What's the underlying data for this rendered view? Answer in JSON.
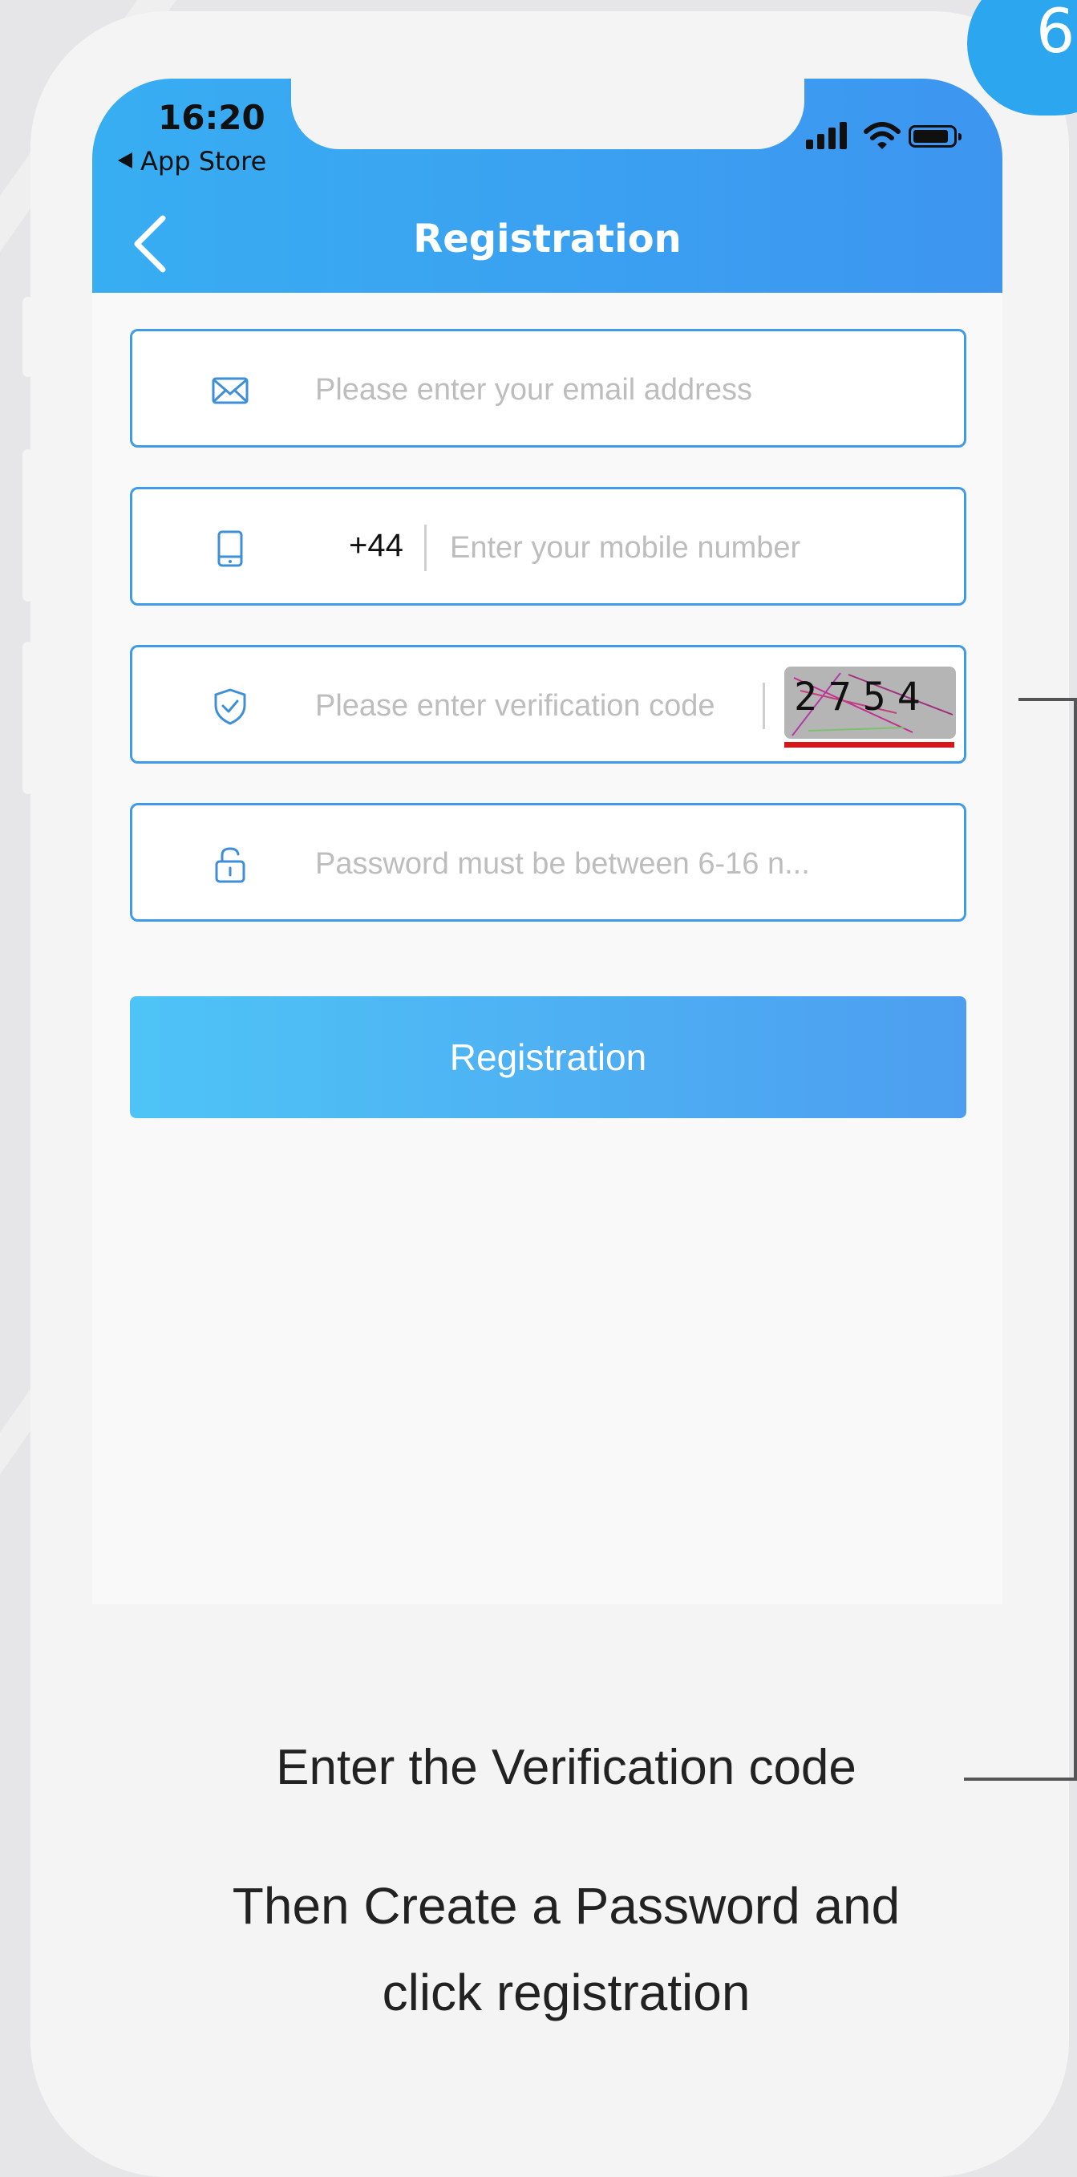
{
  "step": {
    "number": "6"
  },
  "status_bar": {
    "time": "16:20",
    "back_app": "App Store",
    "signal_icon": "cellular-signal-icon",
    "wifi_icon": "wifi-icon",
    "battery_icon": "battery-icon"
  },
  "nav": {
    "title": "Registration",
    "back_icon": "chevron-left-icon"
  },
  "form": {
    "email": {
      "icon": "envelope-icon",
      "placeholder": "Please enter your email address",
      "value": ""
    },
    "mobile": {
      "icon": "mobile-phone-icon",
      "country_code": "+44",
      "placeholder": "Enter your mobile number",
      "value": ""
    },
    "verification": {
      "icon": "shield-check-icon",
      "placeholder": "Please enter verification code",
      "value": "",
      "captcha_text": "2754"
    },
    "password": {
      "icon": "unlock-icon",
      "placeholder": "Password must be between 6-16 n...",
      "value": ""
    },
    "submit_label": "Registration"
  },
  "captions": {
    "line1": "Enter the Verification code",
    "line2": "Then Create a Password and",
    "line3": "click registration"
  },
  "colors": {
    "header_start": "#38aef2",
    "header_end": "#3d95f0",
    "field_border": "#3f9be8",
    "button_start": "#4ec4f6",
    "button_end": "#4d9ef0",
    "captcha_underline": "#d5171a"
  }
}
